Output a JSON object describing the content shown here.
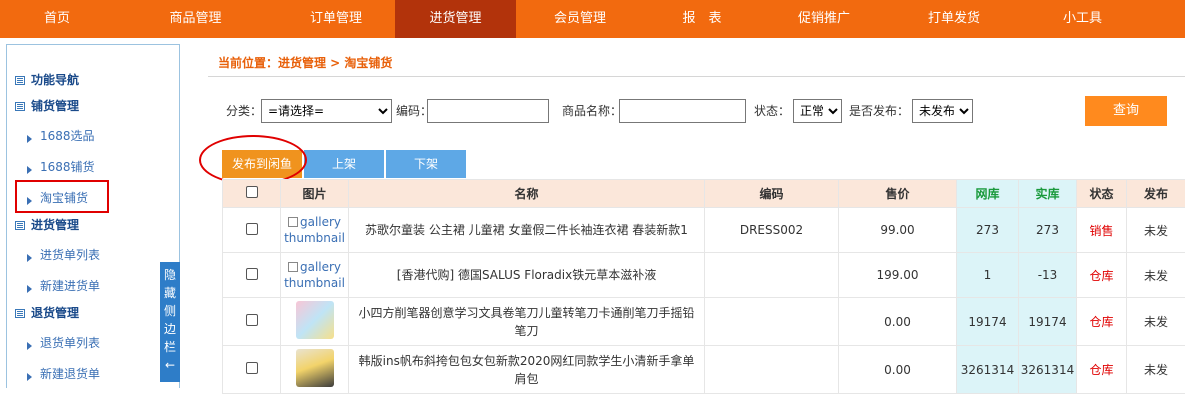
{
  "nav": {
    "items": [
      "首页",
      "商品管理",
      "订单管理",
      "进货管理",
      "会员管理",
      "报　表",
      "促销推广",
      "打单发货",
      "小工具"
    ],
    "active_index": 3
  },
  "sidebar": {
    "rows": [
      {
        "type": "group",
        "label": "功能导航"
      },
      {
        "type": "group",
        "label": "铺货管理"
      },
      {
        "type": "item",
        "label": "1688选品"
      },
      {
        "type": "item",
        "label": "1688铺货"
      },
      {
        "type": "item",
        "label": "淘宝铺货"
      },
      {
        "type": "group",
        "label": "进货管理"
      },
      {
        "type": "item",
        "label": "进货单列表"
      },
      {
        "type": "item",
        "label": "新建进货单"
      },
      {
        "type": "group",
        "label": "退货管理"
      },
      {
        "type": "item",
        "label": "退货单列表"
      },
      {
        "type": "item",
        "label": "新建退货单"
      }
    ],
    "hide_label": "隐藏侧边栏←"
  },
  "breadcrumb": "当前位置：进货管理 > 淘宝铺货",
  "filter": {
    "category_label": "分类：",
    "category_value": "=请选择=",
    "code_label": "编码：",
    "code_value": "",
    "name_label": "商品名称：",
    "name_value": "",
    "status_label": "状态：",
    "status_value": "正常",
    "publish_label": "是否发布：",
    "publish_value": "未发布",
    "query_label": "查询"
  },
  "actions": {
    "publish": "发布到闲鱼",
    "on_shelf": "上架",
    "off_shelf": "下架"
  },
  "table": {
    "headers": [
      "",
      "图片",
      "名称",
      "编码",
      "售价",
      "网库",
      "实库",
      "状态",
      "发布"
    ],
    "rows": [
      {
        "image": "gallery thumbnail",
        "name": "苏歌尔童装 公主裙 儿童裙 女童假二件长袖连衣裙 春装新款1",
        "code": "DRESS002",
        "price": "99.00",
        "net": "273",
        "real": "273",
        "status": "销售",
        "publish": "未发"
      },
      {
        "image": "gallery thumbnail",
        "name": "[香港代购] 德国SALUS Floradix铁元草本滋补液",
        "code": "",
        "price": "199.00",
        "net": "1",
        "real": "-13",
        "status": "仓库",
        "publish": "未发"
      },
      {
        "image": "",
        "name": "小四方削笔器创意学习文具卷笔刀儿童转笔刀卡通削笔刀手摇铅笔刀",
        "code": "",
        "price": "0.00",
        "net": "19174",
        "real": "19174",
        "status": "仓库",
        "publish": "未发"
      },
      {
        "image": "",
        "name": "韩版ins帆布斜挎包包女包新款2020网红同款学生小清新手拿单肩包",
        "code": "",
        "price": "0.00",
        "net": "3261314",
        "real": "3261314",
        "status": "仓库",
        "publish": "未发"
      }
    ]
  },
  "colors": {
    "nav_bg": "#f26a0f",
    "nav_active": "#b2330b",
    "accent": "#e8600a",
    "blue_btn": "#5ea8e6",
    "status_red": "#e00000"
  }
}
